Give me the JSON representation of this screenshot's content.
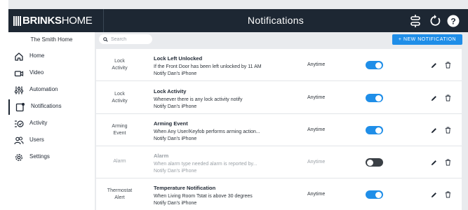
{
  "header": {
    "brand_bold": "BRINKS",
    "brand_light": "HOME",
    "title": "Notifications",
    "icons": [
      "settings-sliders-icon",
      "refresh-icon",
      "help-icon"
    ]
  },
  "sidebar": {
    "home_name": "The Smith Home",
    "items": [
      {
        "label": "Home",
        "icon": "home-icon"
      },
      {
        "label": "Video",
        "icon": "video-icon"
      },
      {
        "label": "Automation",
        "icon": "automation-icon"
      },
      {
        "label": "Notifications",
        "icon": "notifications-icon",
        "active": true
      },
      {
        "label": "Activity",
        "icon": "activity-icon"
      },
      {
        "label": "Users",
        "icon": "users-icon"
      },
      {
        "label": "Settings",
        "icon": "settings-gear-icon"
      }
    ]
  },
  "toolbar": {
    "search_placeholder": "Search",
    "new_label": "+ NEW NOTIFICATION"
  },
  "notifications": [
    {
      "category_line1": "Lock",
      "category_line2": "Activity",
      "name": "Lock Left Unlocked",
      "desc_line1": "If the Front Door has been left unlocked by 11 AM",
      "desc_line2": "Notify Dan's iPhone",
      "when": "Anytime",
      "enabled": true
    },
    {
      "category_line1": "Lock",
      "category_line2": "Activity",
      "name": "Lock Activity",
      "desc_line1": "Whenever there is any lock activity notify",
      "desc_line2": "Notify Dan's iPhone",
      "when": "Anytime",
      "enabled": true
    },
    {
      "category_line1": "Arming",
      "category_line2": "Event",
      "name": "Arming Event",
      "desc_line1": "When Any User/Keyfob performs arming action...",
      "desc_line2": "Notify Dan's iPhone",
      "when": "Anytime",
      "enabled": true
    },
    {
      "category_line1": "Alarm",
      "category_line2": "",
      "name": "Alarm",
      "desc_line1": "When alarm type needed alarm is reported by...",
      "desc_line2": "Notify Dan's iPhone",
      "when": "Anytime",
      "enabled": false
    },
    {
      "category_line1": "Thermostat",
      "category_line2": "Alert",
      "name": "Temperature Notification",
      "desc_line1": "When Living Room Tstat is above 30 degrees",
      "desc_line2": "Notify Dan's iPhone",
      "when": "Anytime",
      "enabled": true
    }
  ],
  "colors": {
    "header_bg": "#1d2733",
    "accent": "#1f8ee8",
    "toggle_on": "#1f8ee8",
    "toggle_off": "#3a3f45"
  }
}
